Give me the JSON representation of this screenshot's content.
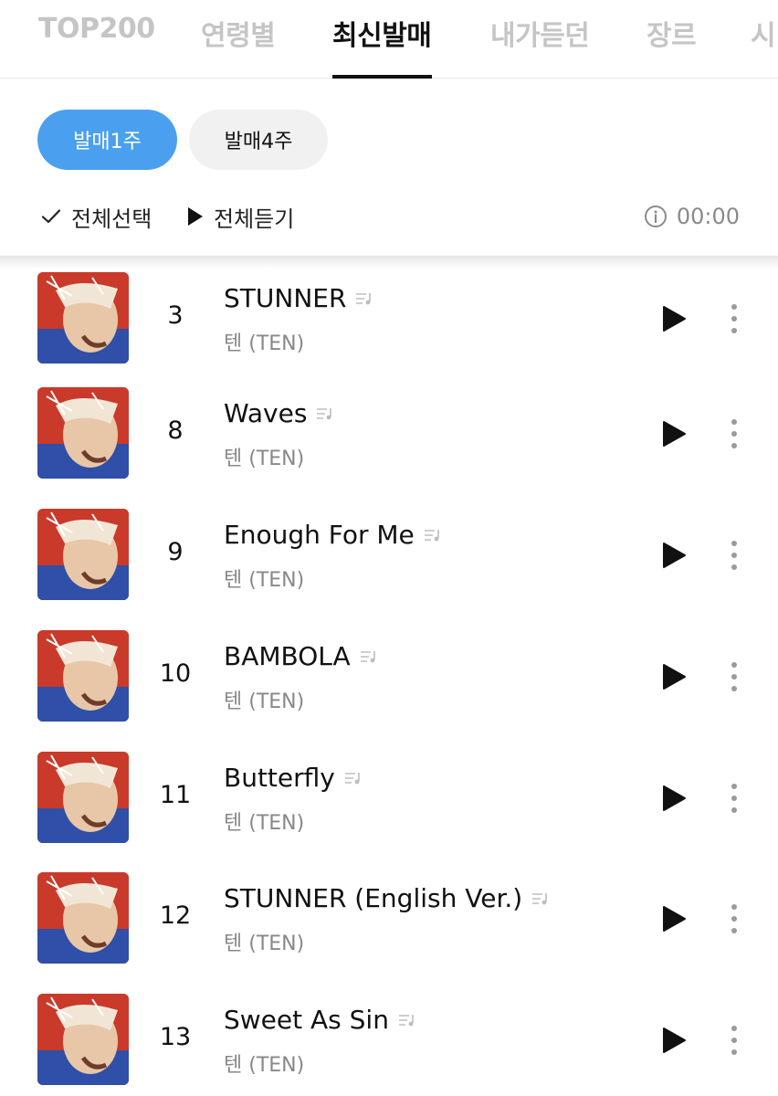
{
  "tabs": [
    {
      "label": "TOP200",
      "active": false
    },
    {
      "label": "연령별",
      "active": false
    },
    {
      "label": "최신발매",
      "active": true
    },
    {
      "label": "내가듣던",
      "active": false
    },
    {
      "label": "장르",
      "active": false
    },
    {
      "label": "시",
      "active": false
    }
  ],
  "filters": {
    "week1": "발매1주",
    "week4": "발매4주"
  },
  "actions": {
    "select_all": "전체선택",
    "listen_all": "전체듣기",
    "time": "00:00"
  },
  "colors": {
    "accent": "#4aa0ef",
    "cover": "#c93a2a"
  },
  "songs": [
    {
      "rank": "3",
      "title": "STUNNER",
      "artist": "텐 (TEN)"
    },
    {
      "rank": "8",
      "title": "Waves",
      "artist": "텐 (TEN)"
    },
    {
      "rank": "9",
      "title": "Enough For Me",
      "artist": "텐 (TEN)"
    },
    {
      "rank": "10",
      "title": "BAMBOLA",
      "artist": "텐 (TEN)"
    },
    {
      "rank": "11",
      "title": "Butterfly",
      "artist": "텐 (TEN)"
    },
    {
      "rank": "12",
      "title": "STUNNER (English Ver.)",
      "artist": "텐 (TEN)"
    },
    {
      "rank": "13",
      "title": "Sweet As Sin",
      "artist": "텐 (TEN)"
    }
  ]
}
